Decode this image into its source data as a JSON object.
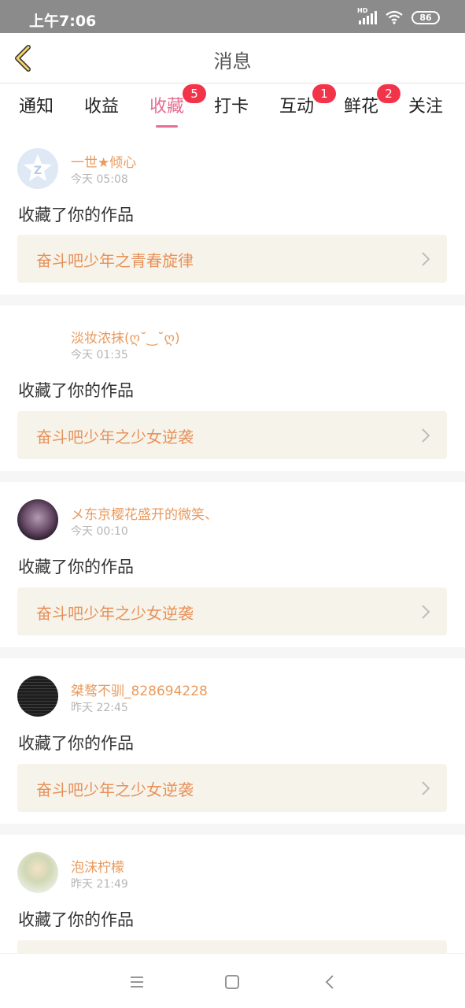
{
  "status_bar": {
    "time": "上午7:06",
    "hd": "HD",
    "battery": "86"
  },
  "header": {
    "title": "消息"
  },
  "tabs": [
    {
      "label": "通知",
      "badge": null
    },
    {
      "label": "收益",
      "badge": null
    },
    {
      "label": "收藏",
      "badge": "5",
      "active": true
    },
    {
      "label": "打卡",
      "badge": null
    },
    {
      "label": "互动",
      "badge": "1"
    },
    {
      "label": "鲜花",
      "badge": "2"
    },
    {
      "label": "关注",
      "badge": null
    }
  ],
  "colors": {
    "accent": "#e66d93",
    "username": "#e99a5c",
    "work_title": "#e8915a",
    "badge": "#f2344a",
    "status_bar": "#8b8b8b"
  },
  "notifications": [
    {
      "user": "一世★倾心",
      "time": "今天 05:08",
      "action": "收藏了你的作品",
      "work": "奋斗吧少年之青春旋律"
    },
    {
      "user": "淡妆浓抹(ღ˘‿˘ღ)",
      "time": "今天 01:35",
      "action": "收藏了你的作品",
      "work": "奋斗吧少年之少女逆袭"
    },
    {
      "user": "メ东京樱花盛开的微笑、",
      "time": "今天 00:10",
      "action": "收藏了你的作品",
      "work": "奋斗吧少年之少女逆袭"
    },
    {
      "user": "桀骜不驯_828694228",
      "time": "昨天 22:45",
      "action": "收藏了你的作品",
      "work": "奋斗吧少年之少女逆袭"
    },
    {
      "user": "泡沫柠檬",
      "time": "昨天 21:49",
      "action": "收藏了你的作品",
      "work": ""
    }
  ]
}
